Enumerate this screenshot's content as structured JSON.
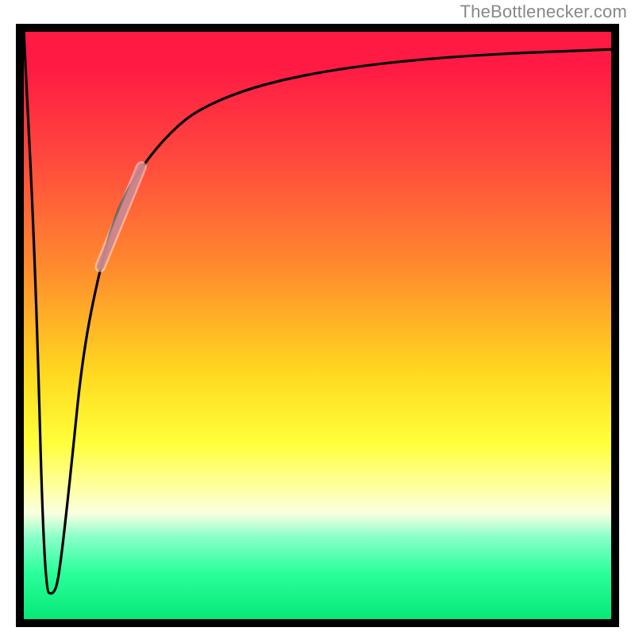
{
  "attribution": "TheBottlenecker.com",
  "chart_data": {
    "type": "line",
    "title": "",
    "xlabel": "",
    "ylabel": "",
    "xlim": [
      0,
      100
    ],
    "ylim": [
      0,
      100
    ],
    "x": [
      0,
      2,
      3.5,
      5,
      6,
      8,
      10,
      13,
      16,
      20,
      25,
      30,
      40,
      55,
      75,
      100
    ],
    "y": [
      100,
      60,
      5,
      4,
      7,
      25,
      45,
      60,
      70,
      77,
      83,
      87,
      91,
      94,
      96,
      97
    ],
    "highlight_segment": {
      "x_start": 13,
      "x_end": 20
    },
    "note": "Interior is a vertical red→green gradient; no tick labels or legend in source."
  },
  "colors": {
    "border": "#000000",
    "curve": "#000000",
    "highlight": "#c8828c",
    "attribution_text": "#888888"
  }
}
